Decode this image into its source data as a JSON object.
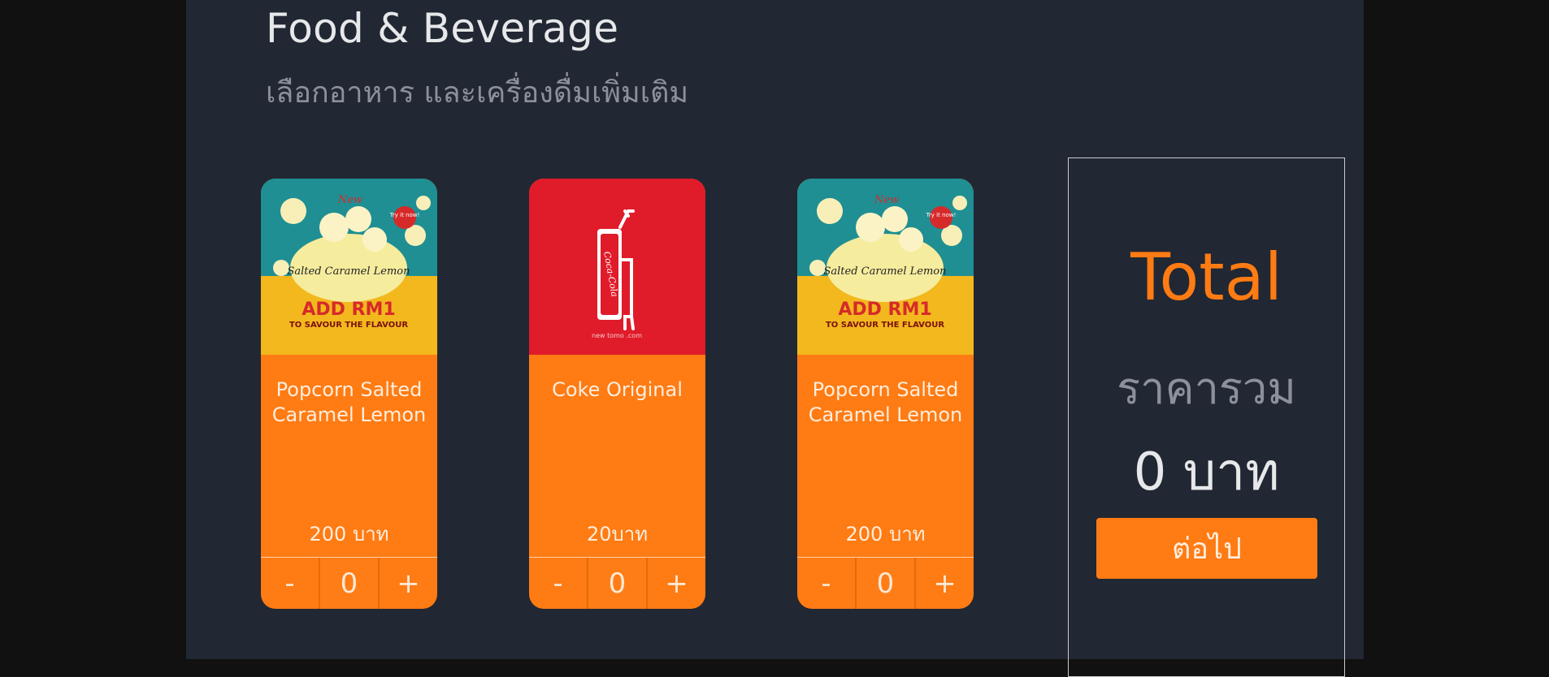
{
  "header": {
    "title": "Food & Beverage",
    "subtitle": "เลือกอาหาร และเครื่องดื่มเพิ่มเติม"
  },
  "products": [
    {
      "name": "Popcorn Salted Caramel Lemon",
      "price": "200 บาท",
      "quantity": "0",
      "minus": "-",
      "plus": "+",
      "image_text": {
        "new": "New",
        "try": "Try it now!",
        "flavour": "Salted Caramel Lemon",
        "promo": "ADD RM1",
        "promo_sub": "TO SAVOUR THE FLAVOUR"
      }
    },
    {
      "name": "Coke Original",
      "price": "20บาท",
      "quantity": "0",
      "minus": "-",
      "plus": "+",
      "image_text": {
        "brand": "Coca-Cola",
        "tag": "new tomo .com"
      }
    },
    {
      "name": "Popcorn Salted Caramel Lemon",
      "price": "200 บาท",
      "quantity": "0",
      "minus": "-",
      "plus": "+",
      "image_text": {
        "new": "New",
        "try": "Try it now!",
        "flavour": "Salted Caramel Lemon",
        "promo": "ADD RM1",
        "promo_sub": "TO SAVOUR THE FLAVOUR"
      }
    }
  ],
  "summary": {
    "title": "Total",
    "subtitle": "ราคารวม",
    "amount": "0 บาท",
    "next_label": "ต่อไป"
  },
  "colors": {
    "accent": "#ff7b13",
    "panel": "#212733",
    "background": "#111111"
  }
}
